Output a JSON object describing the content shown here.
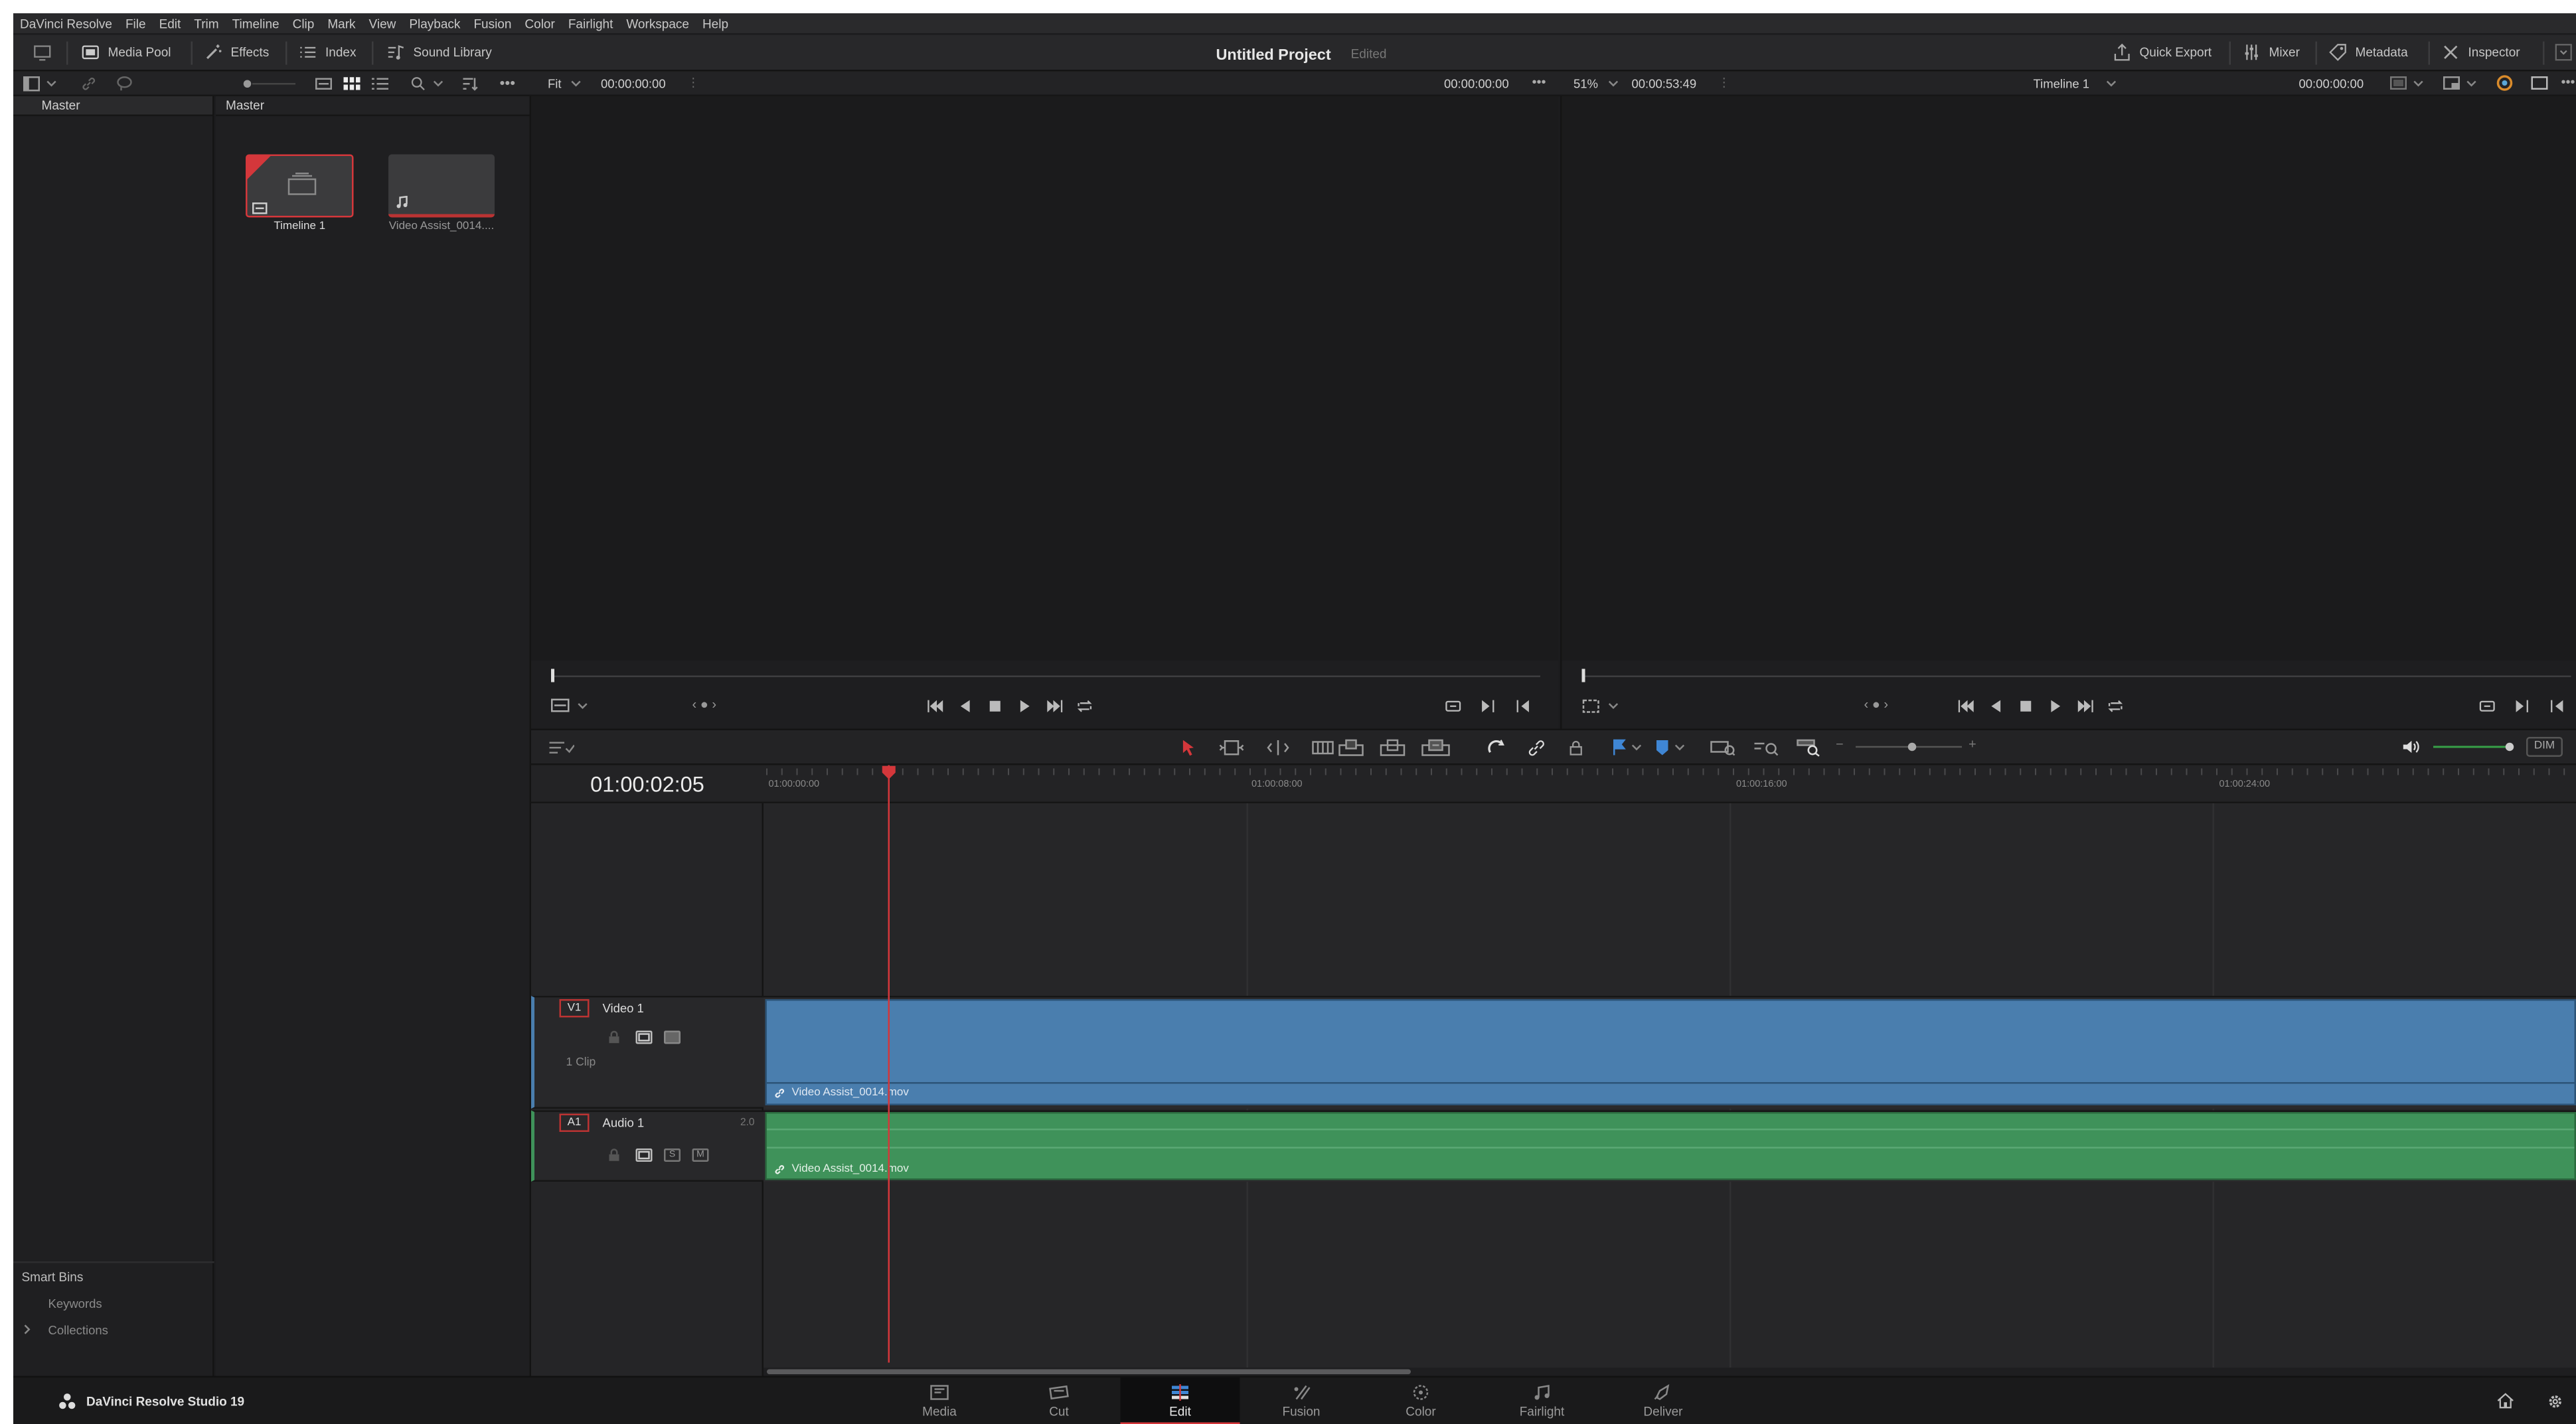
{
  "menu": [
    "DaVinci Resolve",
    "File",
    "Edit",
    "Trim",
    "Timeline",
    "Clip",
    "Mark",
    "View",
    "Playback",
    "Fusion",
    "Color",
    "Fairlight",
    "Workspace",
    "Help"
  ],
  "toolbar": {
    "media_pool": "Media Pool",
    "effects": "Effects",
    "index": "Index",
    "sound_library": "Sound Library",
    "project_title": "Untitled Project",
    "project_status": "Edited",
    "quick_export": "Quick Export",
    "mixer": "Mixer",
    "metadata": "Metadata",
    "inspector": "Inspector"
  },
  "bins": {
    "header": "Master",
    "smart_bins": "Smart Bins",
    "keywords": "Keywords",
    "collections": "Collections"
  },
  "pool": {
    "header": "Master",
    "clips": [
      {
        "label": "Timeline 1",
        "selected": true
      },
      {
        "label": "Video Assist_0014....",
        "selected": false
      }
    ]
  },
  "source_viewer": {
    "zoom": "Fit",
    "timecode_in": "00:00:00:00",
    "timecode_out": "00:00:00:00"
  },
  "timeline_viewer": {
    "zoom": "51%",
    "duration": "00:00:53:49",
    "timeline_name": "Timeline 1",
    "timecode": "00:00:00:00"
  },
  "timeline": {
    "current_timecode": "01:00:02:05",
    "ruler": [
      "01:00:00:00",
      "01:00:08:00",
      "01:00:16:00",
      "01:00:24:00"
    ],
    "dim": "DIM",
    "video_track": {
      "badge": "V1",
      "name": "Video 1",
      "clip_count": "1 Clip",
      "clip_name": "Video Assist_0014.mov"
    },
    "audio_track": {
      "badge": "A1",
      "name": "Audio 1",
      "channels": "2.0",
      "solo": "S",
      "mute": "M",
      "clip_name": "Video Assist_0014.mov"
    }
  },
  "brand": "DaVinci Resolve Studio 19",
  "pages": [
    "Media",
    "Cut",
    "Edit",
    "Fusion",
    "Color",
    "Fairlight",
    "Deliver"
  ],
  "active_page": "Edit",
  "colors": {
    "accent": "#d4373b",
    "video_clip": "#4a7eae",
    "audio_clip": "#3f925a"
  }
}
